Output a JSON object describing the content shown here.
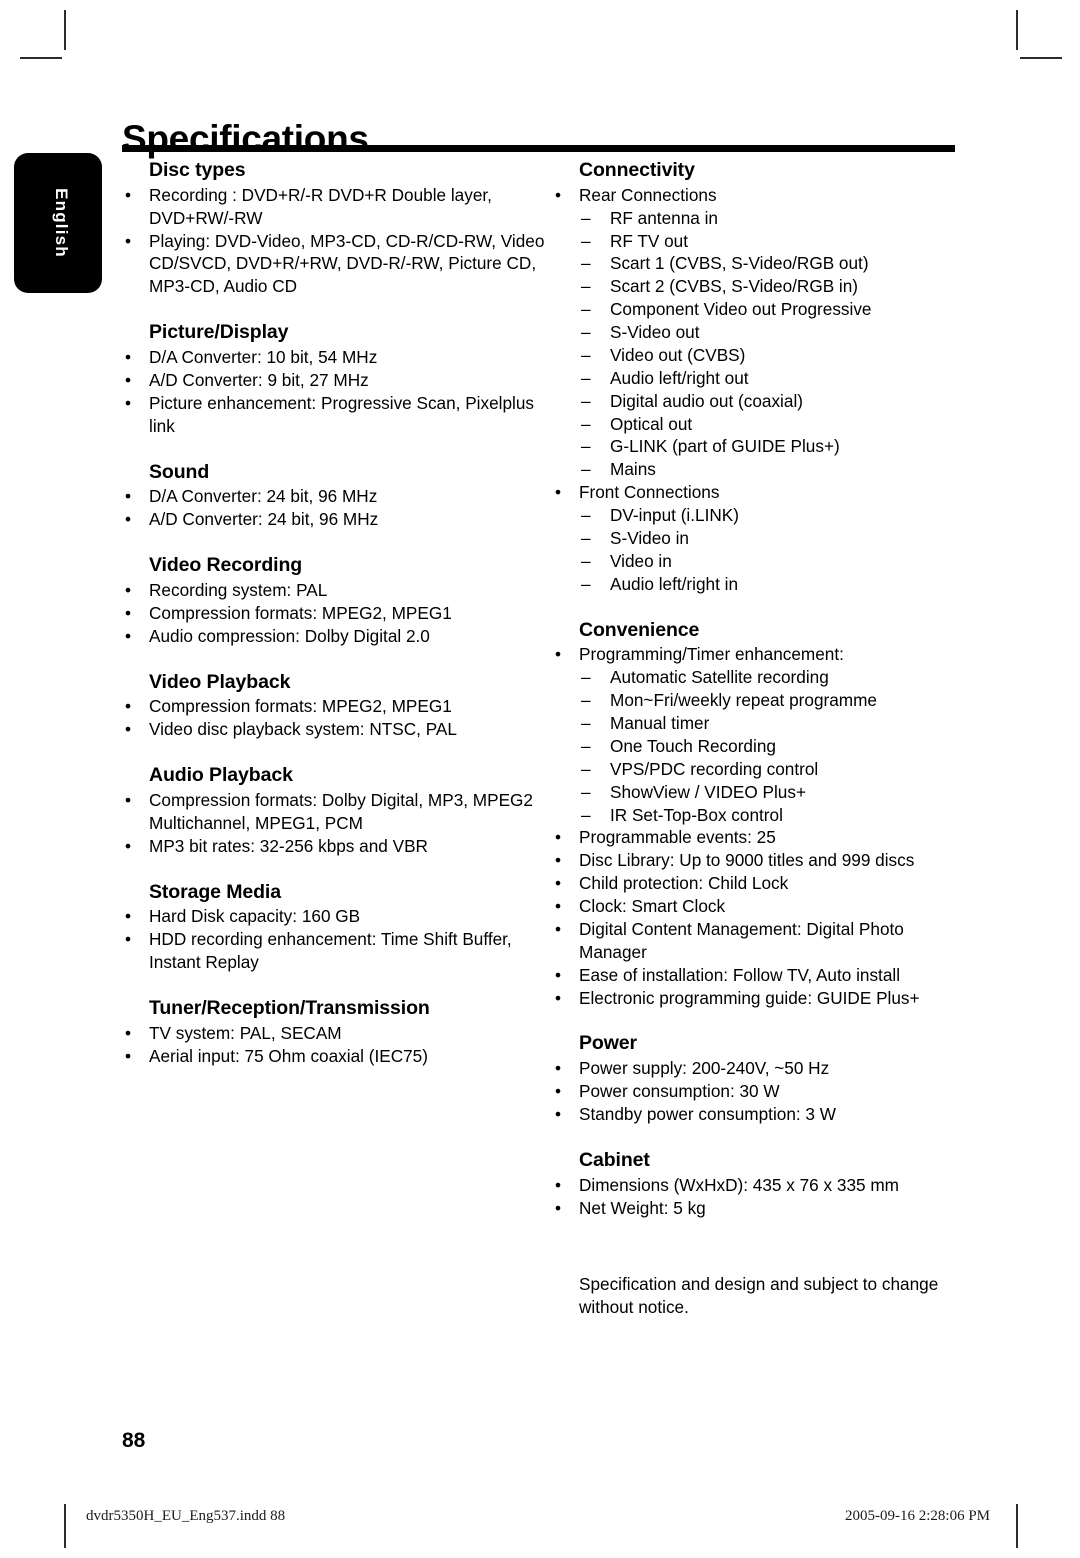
{
  "page": {
    "title": "Specifications",
    "language_tab": "English",
    "page_number": "88",
    "footer_file": "dvdr5350H_EU_Eng537.indd   88",
    "footer_date": "2005-09-16   2:28:06 PM",
    "note": "Specification and design and subject to change without notice."
  },
  "left_column": {
    "sections": [
      {
        "heading": "Disc types",
        "items": [
          {
            "text": "Recording : DVD+R/-R DVD+R Double layer, DVD+RW/-RW"
          },
          {
            "text": "Playing: DVD-Video, MP3-CD, CD-R/CD-RW, Video CD/SVCD, DVD+R/+RW, DVD-R/-RW, Picture CD, MP3-CD, Audio CD"
          }
        ]
      },
      {
        "heading": "Picture/Display",
        "items": [
          {
            "text": "D/A Converter: 10 bit, 54 MHz"
          },
          {
            "text": "A/D Converter: 9 bit, 27 MHz"
          },
          {
            "text": "Picture enhancement: Progressive Scan, Pixelplus link"
          }
        ]
      },
      {
        "heading": "Sound",
        "items": [
          {
            "text": "D/A Converter: 24 bit, 96 MHz"
          },
          {
            "text": "A/D Converter: 24 bit, 96 MHz"
          }
        ]
      },
      {
        "heading": "Video Recording",
        "items": [
          {
            "text": "Recording system: PAL"
          },
          {
            "text": "Compression formats: MPEG2, MPEG1"
          },
          {
            "text": "Audio compression: Dolby Digital 2.0"
          }
        ]
      },
      {
        "heading": "Video Playback",
        "items": [
          {
            "text": "Compression formats: MPEG2, MPEG1"
          },
          {
            "text": "Video disc playback system: NTSC, PAL"
          }
        ]
      },
      {
        "heading": "Audio Playback",
        "items": [
          {
            "text": "Compression formats: Dolby Digital, MP3, MPEG2 Multichannel, MPEG1, PCM"
          },
          {
            "text": "MP3 bit rates: 32-256 kbps and VBR"
          }
        ]
      },
      {
        "heading": "Storage Media",
        "items": [
          {
            "text": "Hard Disk capacity: 160 GB"
          },
          {
            "text": "HDD recording enhancement: Time Shift Buffer, Instant Replay"
          }
        ]
      },
      {
        "heading": "Tuner/Reception/Transmission",
        "items": [
          {
            "text": "TV system: PAL, SECAM"
          },
          {
            "text": "Aerial input: 75 Ohm coaxial (IEC75)"
          }
        ]
      }
    ]
  },
  "right_column": {
    "sections": [
      {
        "heading": "Connectivity",
        "items": [
          {
            "text": "Rear Connections",
            "sub": [
              "RF antenna in",
              "RF TV out",
              "Scart 1 (CVBS, S-Video/RGB out)",
              "Scart 2 (CVBS, S-Video/RGB in)",
              "Component Video out Progressive",
              "S-Video out",
              "Video out (CVBS)",
              "Audio left/right out",
              "Digital audio out (coaxial)",
              "Optical out",
              "G-LINK (part of GUIDE Plus+)",
              "Mains"
            ]
          },
          {
            "text": "Front Connections",
            "sub": [
              "DV-input (i.LINK)",
              "S-Video in",
              "Video in",
              "Audio left/right in"
            ]
          }
        ]
      },
      {
        "heading": "Convenience",
        "items": [
          {
            "text": "Programming/Timer enhancement:",
            "sub": [
              "Automatic Satellite recording",
              "Mon~Fri/weekly repeat programme",
              "Manual timer",
              "One Touch Recording",
              "VPS/PDC recording control",
              "ShowView / VIDEO Plus+",
              "IR Set-Top-Box control"
            ]
          },
          {
            "text": "Programmable events: 25"
          },
          {
            "text": "Disc Library: Up to 9000 titles and 999 discs"
          },
          {
            "text": "Child protection: Child Lock"
          },
          {
            "text": "Clock: Smart Clock"
          },
          {
            "text": "Digital Content Management: Digital Photo Manager"
          },
          {
            "text": "Ease of installation: Follow TV, Auto install"
          },
          {
            "text": "Electronic programming guide: GUIDE Plus+"
          }
        ]
      },
      {
        "heading": "Power",
        "items": [
          {
            "text": "Power supply: 200-240V, ~50 Hz"
          },
          {
            "text": "Power consumption: 30 W"
          },
          {
            "text": "Standby power consumption: 3 W"
          }
        ]
      },
      {
        "heading": "Cabinet",
        "items": [
          {
            "text": "Dimensions (WxHxD): 435 x 76 x 335 mm"
          },
          {
            "text": "Net Weight: 5 kg"
          }
        ]
      }
    ]
  },
  "markers": {
    "bullet": "•",
    "dash": "–"
  }
}
